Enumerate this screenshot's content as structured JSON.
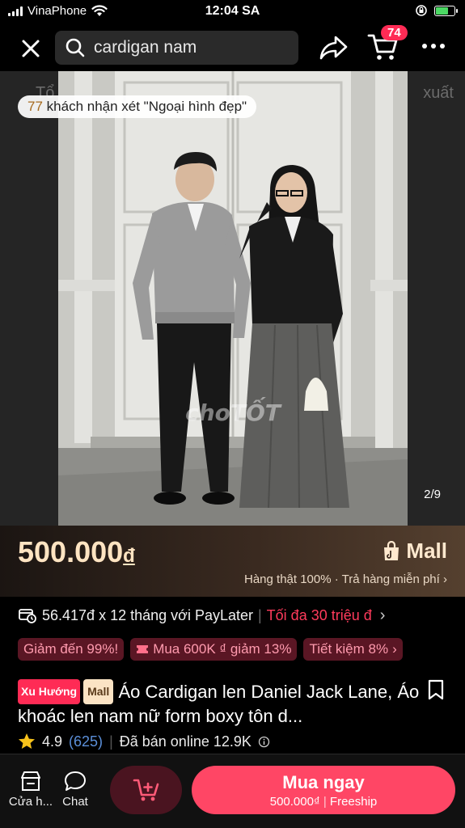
{
  "status_bar": {
    "carrier": "VinaPhone",
    "time": "12:04 SA"
  },
  "top_bar": {
    "search_text": "cardigan nam",
    "cart_count": "74"
  },
  "gallery": {
    "behind_left": "Tổ",
    "behind_right": "xuất",
    "review_count": "77",
    "review_text": "khách nhận xét \"Ngoại hình đẹp\"",
    "watermark": "choTỐT",
    "counter": "2/9"
  },
  "price": {
    "amount": "500.000",
    "currency": "đ",
    "mall_label": "Mall",
    "subtext": "Hàng thật 100% · Trả hàng miễn phí"
  },
  "paylater": {
    "installment": "56.417đ x 12 tháng với PayLater",
    "limit": "Tối đa 30 triệu đ"
  },
  "promos": [
    "Giảm đến 99%!",
    "Mua 600K ₫ giảm 13%",
    "Tiết kiệm 8%"
  ],
  "product": {
    "tag_trend": "Xu Hướng",
    "tag_mall": "Mall",
    "title": "Áo Cardigan len Daniel Jack Lane, Áo khoác len nam nữ form boxy tôn d..."
  },
  "rating": {
    "score": "4.9",
    "count": "(625)",
    "sold": "Đã bán online 12.9K"
  },
  "bottom_bar": {
    "store_label": "Cửa h...",
    "chat_label": "Chat",
    "buy_label": "Mua ngay",
    "buy_price": "500.000₫",
    "buy_ship": "Freeship"
  }
}
